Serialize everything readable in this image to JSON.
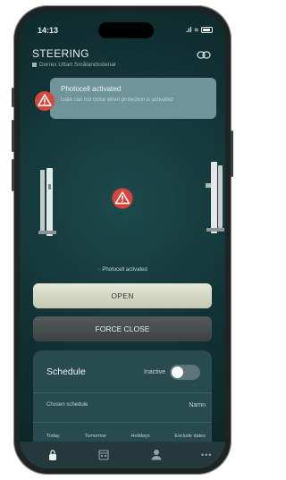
{
  "status_bar": {
    "time": "14:13"
  },
  "header": {
    "title": "STEERING",
    "subtitle": "Dorrex Uttart Smålandsstenar"
  },
  "notification": {
    "title": "Photocell activated",
    "message": "Gate can not close when protection is activated"
  },
  "photocell_status": "Photocell activated",
  "actions": {
    "open_label": "OPEN",
    "force_close_label": "FORCE CLOSE"
  },
  "schedule": {
    "title": "Schedule",
    "status": "Inactive",
    "enabled": false,
    "chosen_label": "Chosen schedule",
    "chosen_value": "Namn",
    "tabs": [
      "Today",
      "Tomorrow",
      "Holidays",
      "Exclude dates"
    ]
  },
  "bottom_nav": [
    {
      "icon": "lock-icon"
    },
    {
      "icon": "calendar-icon"
    },
    {
      "icon": "user-icon"
    },
    {
      "icon": "more-icon"
    }
  ],
  "colors": {
    "accent": "#d9443b",
    "background": "#113033",
    "open_button": "#dcdfcb",
    "force_button": "#4a4f51"
  }
}
